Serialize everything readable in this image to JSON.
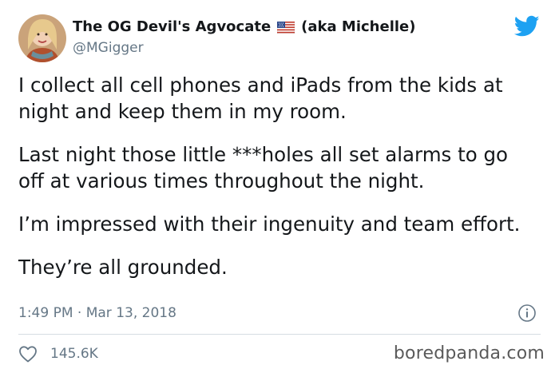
{
  "author": {
    "display_name": "The OG Devil's Agvocate",
    "name_suffix": "(aka Michelle)",
    "handle": "@MGigger",
    "flag_icon": "us-flag-icon",
    "avatar_icon": "avatar-photo"
  },
  "brand_icon": "twitter-bird-icon",
  "tweet": {
    "paragraphs": [
      "I collect all cell phones and iPads from the kids at night and keep them in my room.",
      "Last night those little ***holes all set alarms to go off at various times throughout the night.",
      "I’m impressed with their ingenuity and team effort.",
      "They’re all grounded."
    ],
    "timestamp": "1:49 PM · Mar 13, 2018"
  },
  "engagement": {
    "likes": "145.6K",
    "like_icon": "heart-outline-icon",
    "info_icon": "info-icon"
  },
  "watermark": "boredpanda.com",
  "colors": {
    "text": "#14171a",
    "secondary": "#657786",
    "twitter_blue": "#1da1f2",
    "divider": "#d6dde3"
  }
}
